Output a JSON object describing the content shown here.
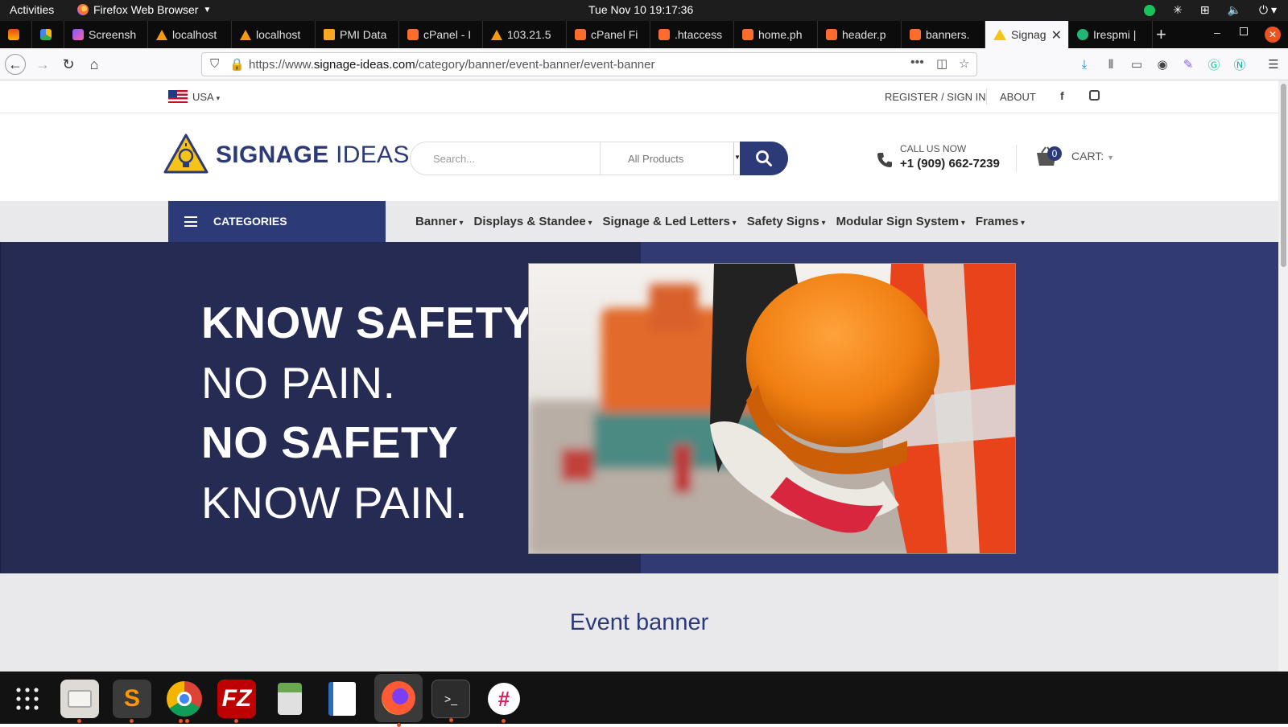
{
  "system": {
    "activities": "Activities",
    "app_name": "Firefox Web Browser",
    "clock": "Tue Nov 10  19:17:36"
  },
  "tabs": [
    {
      "label": "",
      "icon": "app-icon"
    },
    {
      "label": "",
      "icon": "drive-icon"
    },
    {
      "label": "Screensh",
      "icon": "screenshot-icon"
    },
    {
      "label": "localhost",
      "icon": "phpmyadmin-icon"
    },
    {
      "label": "localhost",
      "icon": "phpmyadmin-icon"
    },
    {
      "label": "PMI Data",
      "icon": "slides-icon"
    },
    {
      "label": "cPanel - I",
      "icon": "cpanel-icon"
    },
    {
      "label": "103.21.5",
      "icon": "phpmyadmin-icon"
    },
    {
      "label": "cPanel Fi",
      "icon": "cpanel-icon"
    },
    {
      "label": ".htaccess",
      "icon": "cpanel-icon"
    },
    {
      "label": "home.ph",
      "icon": "cpanel-icon"
    },
    {
      "label": "header.p",
      "icon": "cpanel-icon"
    },
    {
      "label": "banners.",
      "icon": "cpanel-icon"
    },
    {
      "label": "Signag",
      "icon": "warning-icon",
      "active": true
    },
    {
      "label": "Irespmi |",
      "icon": "site-icon"
    }
  ],
  "browser": {
    "url_prefix": "https://www.",
    "url_domain": "signage-ideas.com",
    "url_path": "/category/banner/event-banner/event-banner"
  },
  "site": {
    "country": "USA",
    "register": "REGISTER / SIGN IN",
    "about": "ABOUT",
    "logo_bold": "SIGNAGE",
    "logo_light": "IDEAS",
    "search_placeholder": "Search...",
    "search_category": "All Products",
    "call_label": "CALL US NOW",
    "call_number": "+1 (909) 662-7239",
    "cart_count": "0",
    "cart_label": "CART:",
    "categories_label": "CATEGORIES",
    "menu": [
      "Banner",
      "Displays & Standee",
      "Signage & Led Letters",
      "Safety Signs",
      "Modular Sign System",
      "Frames"
    ],
    "hero": [
      "KNOW SAFETY",
      "NO PAIN.",
      "NO SAFETY",
      "KNOW PAIN."
    ],
    "page_title": "Event banner"
  },
  "colors": {
    "brand_navy": "#2d3a78",
    "hero_dark": "#262b54",
    "hero_mid": "#313a72",
    "accent_orange": "#f08a1c"
  }
}
